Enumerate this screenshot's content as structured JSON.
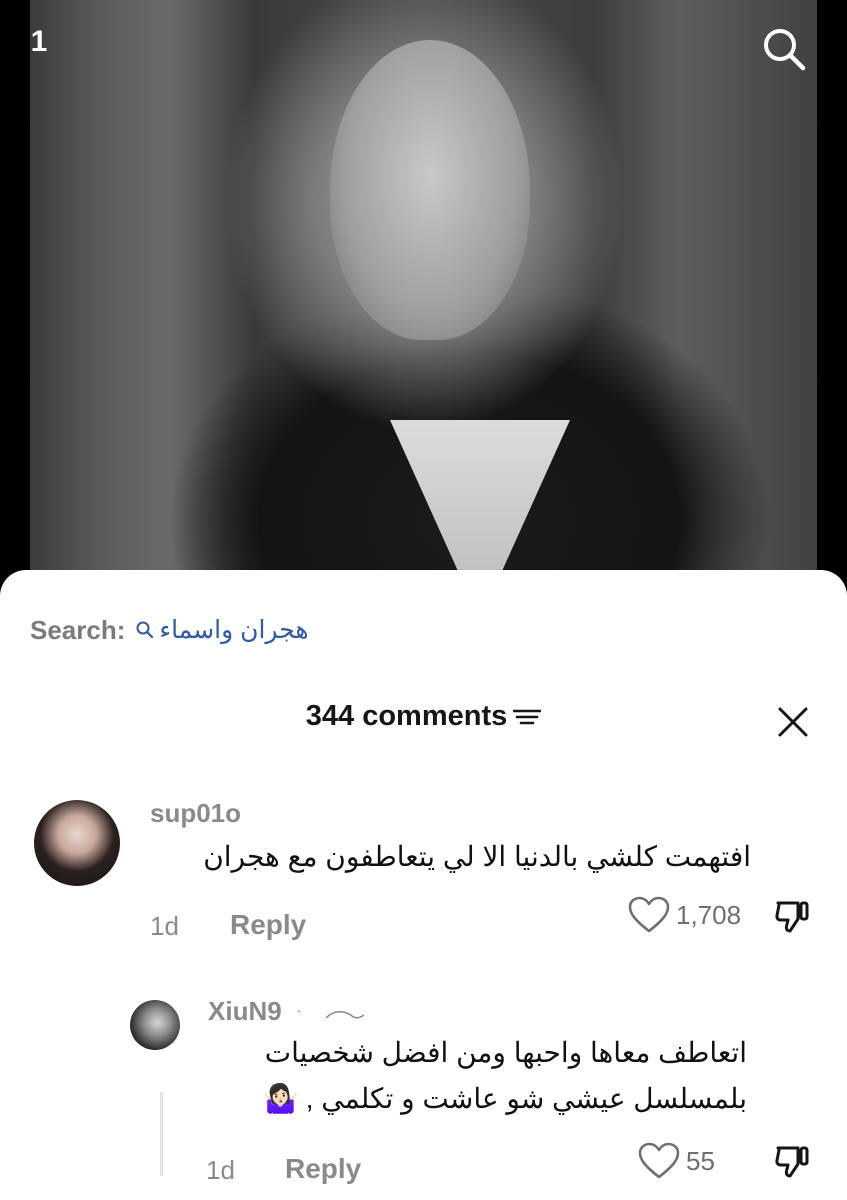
{
  "video": {
    "channel_badge": "1",
    "search_icon": "search-icon"
  },
  "search": {
    "label": "Search:",
    "query": "هجران واسماء",
    "icon": "search-icon"
  },
  "comments_header": {
    "count_label": "344 comments",
    "sort_icon": "filter-lines-icon",
    "close_icon": "close-icon"
  },
  "comments": [
    {
      "username": "sup01o",
      "text": "افتهمت كلشي بالدنيا الا لي يتعاطفون مع هجران",
      "time": "1d",
      "reply_label": "Reply",
      "likes": "1,708"
    },
    {
      "username": "XiuN9",
      "text": "اتعاطف معاها واحبها ومن افضل شخصيات بلمسلسل عيشي شو عاشت و تكلمي , 🤷🏻‍♀️",
      "time": "1d",
      "reply_label": "Reply",
      "likes": "55"
    }
  ]
}
